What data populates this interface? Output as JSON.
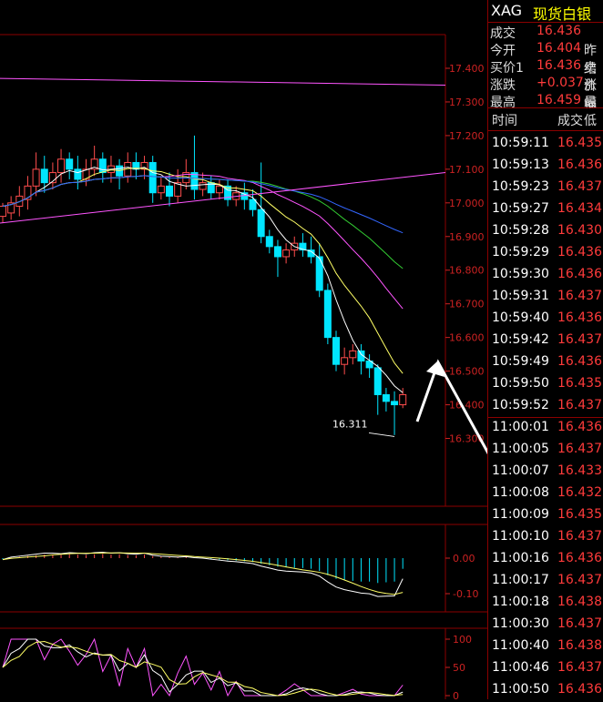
{
  "side": {
    "symbol": "XAG",
    "name": "现货白银",
    "quotes": [
      {
        "label": "成交",
        "value": "16.436",
        "sub": ""
      },
      {
        "label": "今开",
        "value": "16.404",
        "sub": "昨结"
      },
      {
        "label": "买价1",
        "value": "16.436",
        "sub": "卖价"
      },
      {
        "label": "涨跌",
        "value": "+0.037",
        "sub": "涨幅"
      },
      {
        "label": "最高",
        "value": "16.459",
        "sub": "最低"
      }
    ],
    "tick_header": {
      "time": "时间",
      "price": "成交"
    },
    "ticks": [
      {
        "time": "10:59:11",
        "price": "16.435"
      },
      {
        "time": "10:59:13",
        "price": "16.436"
      },
      {
        "time": "10:59:23",
        "price": "16.437"
      },
      {
        "time": "10:59:27",
        "price": "16.434"
      },
      {
        "time": "10:59:28",
        "price": "16.430"
      },
      {
        "time": "10:59:29",
        "price": "16.436"
      },
      {
        "time": "10:59:30",
        "price": "16.436"
      },
      {
        "time": "10:59:31",
        "price": "16.437"
      },
      {
        "time": "10:59:40",
        "price": "16.436"
      },
      {
        "time": "10:59:42",
        "price": "16.437"
      },
      {
        "time": "10:59:49",
        "price": "16.436"
      },
      {
        "time": "10:59:50",
        "price": "16.435"
      },
      {
        "time": "10:59:52",
        "price": "16.437"
      },
      {
        "time": "11:00:01",
        "price": "16.436"
      },
      {
        "time": "11:00:05",
        "price": "16.437"
      },
      {
        "time": "11:00:07",
        "price": "16.433"
      },
      {
        "time": "11:00:08",
        "price": "16.432"
      },
      {
        "time": "11:00:09",
        "price": "16.435"
      },
      {
        "time": "11:00:10",
        "price": "16.437"
      },
      {
        "time": "11:00:16",
        "price": "16.436"
      },
      {
        "time": "11:00:17",
        "price": "16.437"
      },
      {
        "time": "11:00:18",
        "price": "16.438"
      },
      {
        "time": "11:00:30",
        "price": "16.437"
      },
      {
        "time": "11:00:40",
        "price": "16.438"
      },
      {
        "time": "11:00:46",
        "price": "16.437"
      },
      {
        "time": "11:00:50",
        "price": "16.436"
      }
    ],
    "colors": {
      "up": "#ff3b3b",
      "label": "#dddddd",
      "accent": "#ffff00"
    }
  },
  "chart_data": [
    {
      "type": "candlestick",
      "ylim": [
        16.25,
        17.45
      ],
      "y_ticks": [
        "17.400",
        "17.300",
        "17.200",
        "17.100",
        "17.000",
        "16.900",
        "16.800",
        "16.700",
        "16.600",
        "16.500",
        "16.400",
        "16.300"
      ],
      "y_tick_values": [
        17.4,
        17.3,
        17.2,
        17.1,
        17.0,
        16.9,
        16.8,
        16.7,
        16.6,
        16.5,
        16.4,
        16.3
      ],
      "annotation": {
        "text": "16.311",
        "value": 16.311
      },
      "candles": [
        [
          16.96,
          16.99,
          16.94,
          17.0
        ],
        [
          16.97,
          17.0,
          16.95,
          17.02
        ],
        [
          16.99,
          17.02,
          16.96,
          17.05
        ],
        [
          17.01,
          17.05,
          16.98,
          17.08
        ],
        [
          17.05,
          17.1,
          17.02,
          17.15
        ],
        [
          17.1,
          17.06,
          17.03,
          17.14
        ],
        [
          17.06,
          17.09,
          17.04,
          17.12
        ],
        [
          17.09,
          17.13,
          17.06,
          17.16
        ],
        [
          17.13,
          17.1,
          17.07,
          17.15
        ],
        [
          17.1,
          17.07,
          17.04,
          17.14
        ],
        [
          17.07,
          17.1,
          17.05,
          17.13
        ],
        [
          17.1,
          17.13,
          17.08,
          17.17
        ],
        [
          17.13,
          17.09,
          17.06,
          17.15
        ],
        [
          17.09,
          17.11,
          17.06,
          17.14
        ],
        [
          17.11,
          17.08,
          17.04,
          17.13
        ],
        [
          17.08,
          17.12,
          17.06,
          17.15
        ],
        [
          17.12,
          17.1,
          17.07,
          17.15
        ],
        [
          17.1,
          17.12,
          17.07,
          17.14
        ],
        [
          17.12,
          17.03,
          17.0,
          17.14
        ],
        [
          17.03,
          17.05,
          17.01,
          17.08
        ],
        [
          17.05,
          17.02,
          16.99,
          17.09
        ],
        [
          17.02,
          17.06,
          17.0,
          17.1
        ],
        [
          17.06,
          17.09,
          17.04,
          17.13
        ],
        [
          17.09,
          17.04,
          17.01,
          17.2
        ],
        [
          17.04,
          17.06,
          17.02,
          17.09
        ],
        [
          17.06,
          17.03,
          17.01,
          17.08
        ],
        [
          17.03,
          17.05,
          17.01,
          17.07
        ],
        [
          17.05,
          17.01,
          16.99,
          17.07
        ],
        [
          17.01,
          17.03,
          16.99,
          17.05
        ],
        [
          17.03,
          17.01,
          16.98,
          17.06
        ],
        [
          17.01,
          16.98,
          16.96,
          17.04
        ],
        [
          16.98,
          16.9,
          16.88,
          17.12
        ],
        [
          16.9,
          16.87,
          16.85,
          16.92
        ],
        [
          16.87,
          16.84,
          16.78,
          16.89
        ],
        [
          16.84,
          16.86,
          16.82,
          16.88
        ],
        [
          16.86,
          16.88,
          16.84,
          16.9
        ],
        [
          16.88,
          16.86,
          16.84,
          16.91
        ],
        [
          16.86,
          16.84,
          16.82,
          16.9
        ],
        [
          16.84,
          16.74,
          16.72,
          16.88
        ],
        [
          16.74,
          16.6,
          16.58,
          16.76
        ],
        [
          16.6,
          16.52,
          16.5,
          16.62
        ],
        [
          16.52,
          16.54,
          16.49,
          16.57
        ],
        [
          16.54,
          16.56,
          16.52,
          16.58
        ],
        [
          16.56,
          16.53,
          16.49,
          16.58
        ],
        [
          16.53,
          16.51,
          16.48,
          16.55
        ],
        [
          16.51,
          16.43,
          16.37,
          16.52
        ],
        [
          16.43,
          16.41,
          16.38,
          16.45
        ],
        [
          16.41,
          16.4,
          16.31,
          16.44
        ],
        [
          16.4,
          16.43,
          16.39,
          16.45
        ]
      ]
    },
    {
      "type": "macd",
      "ylim": [
        -0.18,
        0.05
      ],
      "y_ticks": [
        "0.00",
        "-0.10"
      ],
      "y_tick_values": [
        0.0,
        -0.1
      ],
      "histogram": [
        -0.003,
        0.002,
        0.004,
        0.006,
        0.008,
        0.01,
        0.01,
        0.009,
        0.011,
        0.01,
        0.009,
        0.011,
        0.012,
        0.01,
        0.011,
        0.009,
        0.008,
        0.01,
        0.006,
        0.004,
        0.003,
        0.002,
        0.003,
        0.001,
        0.0,
        -0.002,
        -0.004,
        -0.006,
        -0.007,
        -0.009,
        -0.011,
        -0.016,
        -0.02,
        -0.024,
        -0.026,
        -0.027,
        -0.028,
        -0.03,
        -0.036,
        -0.048,
        -0.058,
        -0.062,
        -0.064,
        -0.066,
        -0.066,
        -0.07,
        -0.068,
        -0.066,
        -0.03
      ]
    },
    {
      "type": "oscillator",
      "ylim": [
        0,
        110
      ],
      "y_ticks": [
        "100",
        "50",
        "0"
      ],
      "y_tick_values": [
        100,
        50,
        0
      ]
    }
  ]
}
